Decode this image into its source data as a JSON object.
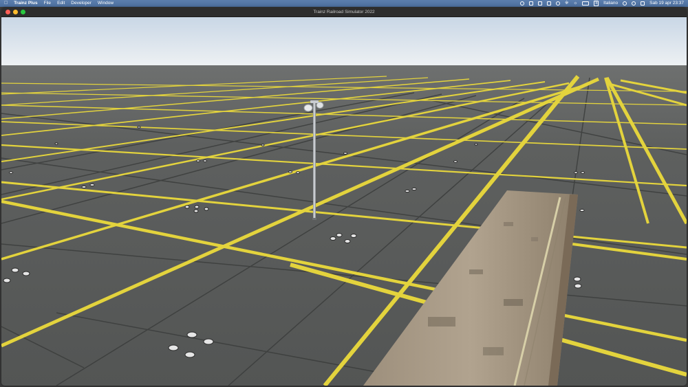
{
  "menubar": {
    "apple_icon": "apple-logo-icon",
    "app_name": "Trainz Plus",
    "menus": [
      "File",
      "Edit",
      "Developer",
      "Window"
    ],
    "status_icons": [
      "activity-icon",
      "screen-mirror-icon",
      "dropbox-icon",
      "print-icon",
      "shield-icon",
      "bluetooth-icon",
      "wifi-icon",
      "battery-icon",
      "input-flag-icon",
      "user-icon",
      "search-icon",
      "control-center-icon"
    ],
    "input_source": "Italiano",
    "datetime": "Sab 19 apr  23:37"
  },
  "window": {
    "title": "Trainz Railroad Simulator 2022",
    "buttons": {
      "close": "#ff5f57",
      "minimize": "#febc2e",
      "zoom": "#28c840"
    }
  },
  "scene": {
    "description_icons": [
      "ground-grid",
      "lamp-post",
      "platform-slab"
    ],
    "colors": {
      "sky_top": "#d2dde9",
      "sky_horizon": "#e9eef2",
      "ground": "#5b5d5c",
      "grid_line": "#e3d33d",
      "platform": "#a89a86"
    }
  }
}
